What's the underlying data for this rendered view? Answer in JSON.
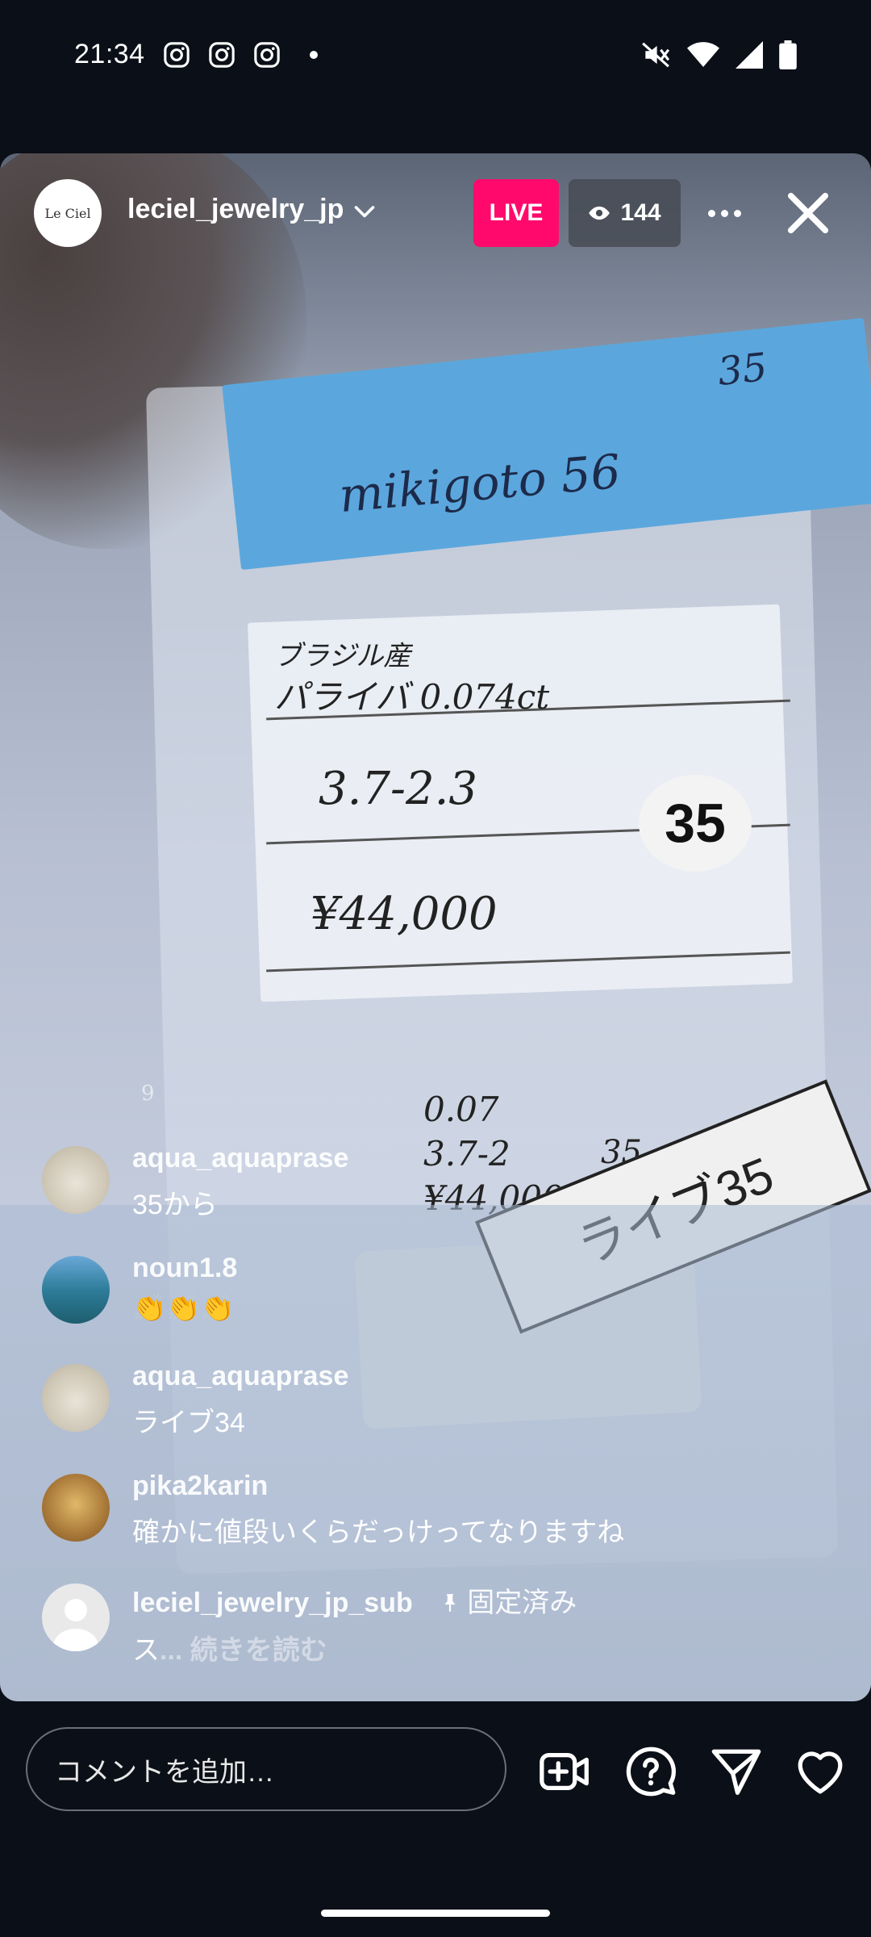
{
  "status_bar": {
    "time": "21:34",
    "notification_icons": [
      "instagram-icon",
      "instagram-icon",
      "instagram-icon"
    ],
    "system_icons": [
      "mute-icon",
      "wifi-icon",
      "signal-icon",
      "battery-icon"
    ]
  },
  "live": {
    "host_avatar_text": "Le Ciel",
    "host_name": "leciel_jewelry_jp",
    "live_label": "LIVE",
    "viewer_count": "144"
  },
  "video": {
    "tape_text": "mikigoto 56",
    "tape_number": "35",
    "label_line1a": "ブラジル産",
    "label_line1b": "パライバ 0.074ct",
    "label_number": "35",
    "label_line2": "3.7-2.3",
    "label_line3": "¥44,000",
    "live_card": "ライブ35",
    "small_card_line1": "0.07",
    "small_card_line2": "3.7-2",
    "small_card_line3": "¥44,000",
    "small_card_num": "35",
    "side_mark": "9"
  },
  "comments": [
    {
      "user": "aqua_aquaprase",
      "text": "35から",
      "avatar_color": "#d8d2c4"
    },
    {
      "user": "noun1.8",
      "text": "👏👏👏",
      "avatar_color": "#3e8aa6"
    },
    {
      "user": "aqua_aquaprase",
      "text": "ライブ34",
      "avatar_color": "#d8d2c4"
    },
    {
      "user": "pika2karin",
      "text": "確かに値段いくらだっけってなりますね",
      "avatar_color": "#c9a05c"
    },
    {
      "user": "leciel_jewelry_jp_sub",
      "pinned_label": "固定済み",
      "text": "ス",
      "read_more": "... 続きを読む",
      "avatar_color": "#e8e8e8"
    }
  ],
  "bottom_bar": {
    "comment_placeholder": "コメントを追加…",
    "icons": [
      "add-video-icon",
      "question-icon",
      "send-icon",
      "heart-icon"
    ]
  },
  "colors": {
    "live_badge": "#ff0a6c",
    "background": "#0b0f17"
  }
}
